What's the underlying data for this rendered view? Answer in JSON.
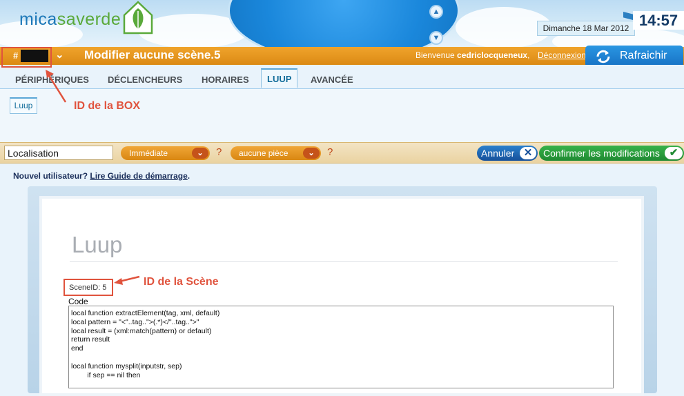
{
  "brand": {
    "logo_part1": "mica",
    "logo_part2": "saverde"
  },
  "datetime": {
    "date": "Dimanche 18 Mar 2012",
    "time": "14:57"
  },
  "top_bar": {
    "box_id_hash": "#",
    "scene_title": "Modifier aucune scène.5",
    "welcome_prefix": "Bienvenue ",
    "username": "cedriclocqueneux",
    "welcome_suffix": ",",
    "logout": "Déconnexion",
    "refresh": "Rafraichir"
  },
  "tabs": [
    {
      "label": "PÉRIPHÉRIQUES"
    },
    {
      "label": "DÉCLENCHEURS"
    },
    {
      "label": "HORAIRES"
    },
    {
      "label": "LUUP",
      "active": true
    },
    {
      "label": "AVANCÉE"
    }
  ],
  "subtab": {
    "label": "Luup"
  },
  "action_bar": {
    "location_value": "Localisation",
    "mode_select": "Immédiate",
    "room_select": "aucune pièce",
    "help": "?",
    "cancel": "Annuler",
    "confirm": "Confirmer les modifications"
  },
  "new_user": {
    "prefix": "Nouvel utilisateur? ",
    "link": "Lire Guide de démarrage",
    "suffix": "."
  },
  "luup_panel": {
    "title": "Luup",
    "scene_id": "SceneID: 5",
    "code_label": "Code",
    "code_lines": [
      "local function extractElement(tag, xml, default)",
      "local pattern = \"<\"..tag..\">(.*)</\"..tag..\">\"",
      "local result = (xml:match(pattern) or default)",
      "return result",
      "end",
      "",
      "local function mysplit(inputstr, sep)",
      "        if sep == nil then"
    ]
  },
  "annotations": {
    "box_id": "ID de la BOX",
    "scene_id": "ID de la Scène"
  },
  "colors": {
    "accent_orange": "#db8a14",
    "annotation_red": "#e0533d",
    "brand_blue": "#1d78b8",
    "brand_green": "#5aa93a"
  }
}
